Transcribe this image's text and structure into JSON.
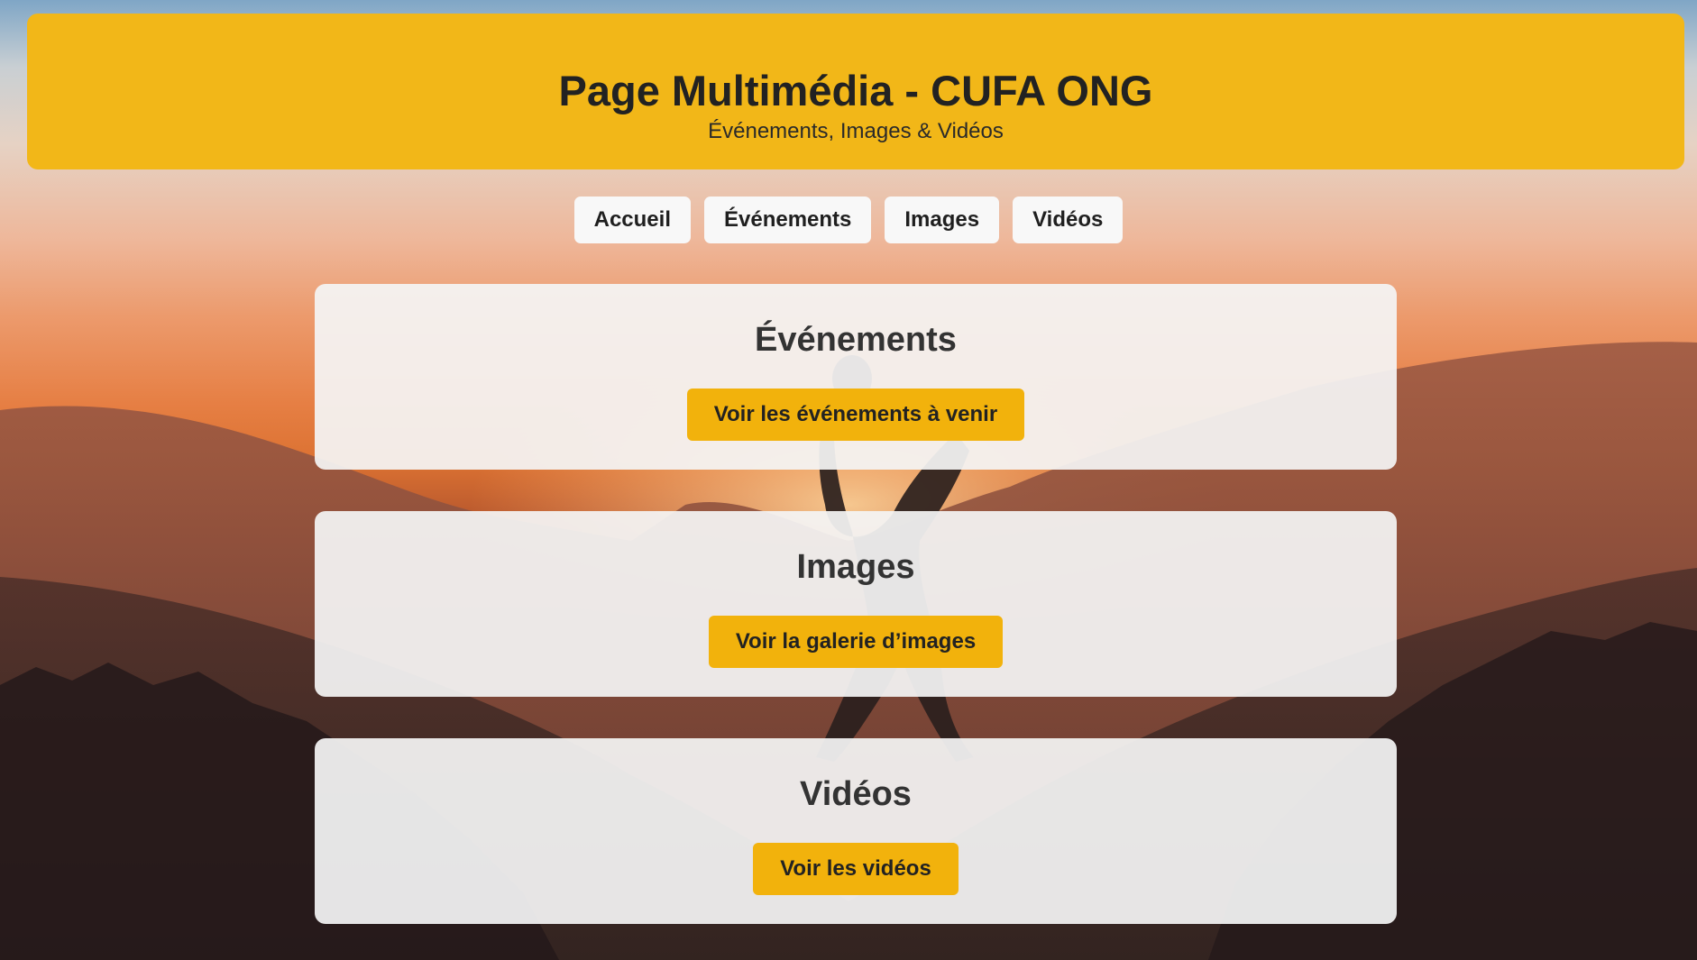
{
  "header": {
    "title": "Page Multimédia - CUFA ONG",
    "subtitle": "Événements, Images & Vidéos"
  },
  "nav": {
    "items": [
      {
        "label": "Accueil"
      },
      {
        "label": "Événements"
      },
      {
        "label": "Images"
      },
      {
        "label": "Vidéos"
      }
    ]
  },
  "sections": [
    {
      "title": "Événements",
      "button_label": "Voir les événements à venir"
    },
    {
      "title": "Images",
      "button_label": "Voir la galerie d’images"
    },
    {
      "title": "Vidéos",
      "button_label": "Voir les vidéos"
    }
  ],
  "colors": {
    "accent": "#f2b718",
    "button": "#f2b20c",
    "card": "#f4f4f4",
    "nav_button": "#f8f8f8"
  }
}
